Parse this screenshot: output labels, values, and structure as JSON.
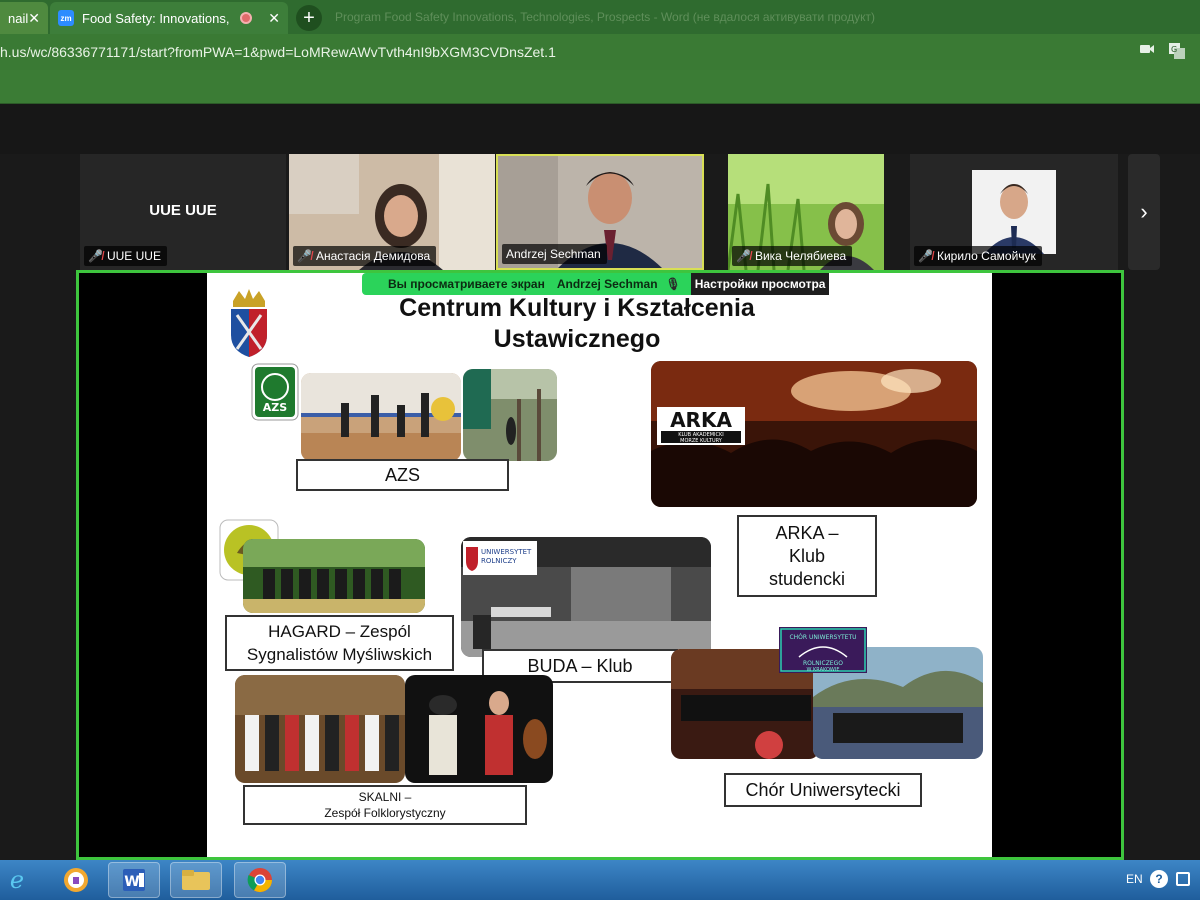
{
  "browser": {
    "tabs": [
      {
        "label": "nail",
        "active": false
      },
      {
        "label": "Food Safety: Innovations, Tec",
        "active": true,
        "icon": "zm"
      }
    ],
    "ghost_title": "Program Food Safety Innovations, Technologies, Prospects - Word (не вдалося активувати продукт)",
    "url": "h.us/wc/86336771171/start?fromPWA=1&pwd=LoMRewAWvTvth4nI9bXGM3CVDnsZet.1"
  },
  "participants": [
    {
      "name": "UUE UUE",
      "display": "UUE UUE",
      "muted": true
    },
    {
      "name": "Анастасія Демидова",
      "muted": true
    },
    {
      "name": "Andrzej Sechman",
      "muted": false,
      "active": true
    },
    {
      "name": "Вика Челябиева",
      "muted": true
    },
    {
      "name": "Кирило Самойчук",
      "muted": true
    }
  ],
  "share_banner": {
    "viewing": "Вы просматриваете экран",
    "presenter": "Andrzej Sechman",
    "view_options": "Настройки просмотра"
  },
  "slide": {
    "title_line1": "Centrum Kultury i Kształcenia",
    "title_line2": "Ustawicznego",
    "captions": {
      "azs": "AZS",
      "arka_line1": "ARKA –",
      "arka_line2": "Klub",
      "arka_line3": "studencki",
      "hagard_line1": "HAGARD –  Zespól",
      "hagard_line2": "Sygnalistów Myśliwskich",
      "buda": "BUDA – Klub",
      "skalni_line1": "SKALNI –",
      "skalni_line2": "Zespół Folklorystyczny",
      "chor": "Chór Uniwersytecki"
    },
    "logos": {
      "arka_big": "ARKA",
      "arka_small1": "KLUB AKADEMICKI",
      "arka_small2": "MORZE KULTURY",
      "azs": "AZS",
      "buda_logo1": "UNIWERSYTET",
      "buda_logo2": "ROLNICZY",
      "chor_logo1": "CHÓR UNIWERSYTETU",
      "chor_logo2": "ROLNICZEGO",
      "chor_logo3": "W KRAKOWIE"
    }
  },
  "taskbar": {
    "lang": "EN"
  },
  "colors": {
    "browser_green": "#3a7a34",
    "share_border": "#3ec53e",
    "banner_green": "#2bd35a",
    "mute_red": "#e5484d"
  }
}
